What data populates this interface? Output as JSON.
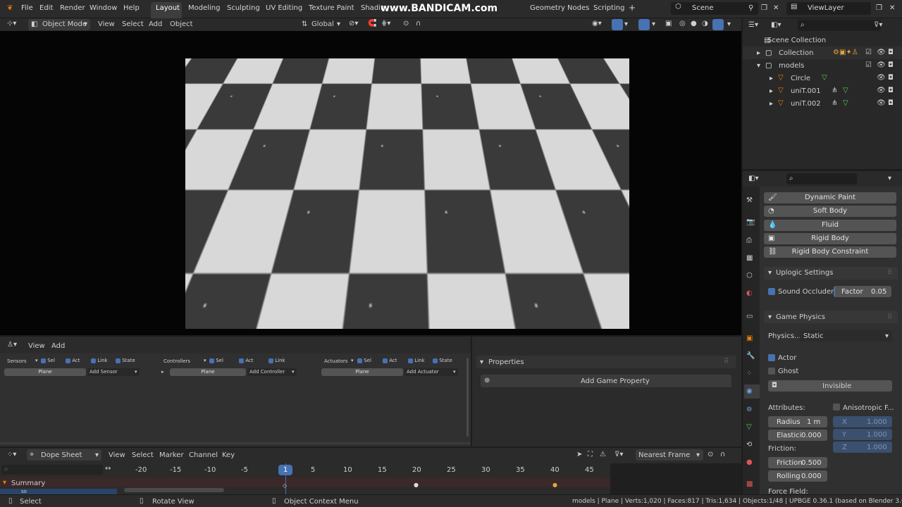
{
  "app": {
    "logo": "blender-logo-icon"
  },
  "menu": [
    "File",
    "Edit",
    "Render",
    "Window",
    "Help"
  ],
  "workspaces": [
    "Layout",
    "Modeling",
    "Sculpting",
    "UV Editing",
    "Texture Paint",
    "Shadin",
    "Geometry Nodes",
    "Scripting"
  ],
  "watermark": "www.BANDICAM.com",
  "scene": {
    "name": "Scene",
    "view_layer": "ViewLayer"
  },
  "viewport_header": {
    "mode": "Object Mode",
    "menus": [
      "View",
      "Select",
      "Add",
      "Object"
    ],
    "orientation": "Global"
  },
  "outliner": {
    "root": "Scene Collection",
    "items": [
      {
        "label": "Collection"
      },
      {
        "label": "models"
      },
      {
        "label": "Circle"
      },
      {
        "label": "uniT.001"
      },
      {
        "label": "uniT.002"
      }
    ]
  },
  "properties": {
    "physics_buttons": [
      "Dynamic Paint",
      "Soft Body",
      "Fluid",
      "Rigid Body",
      "Rigid Body Constraint"
    ],
    "uplogic": {
      "title": "Uplogic Settings",
      "sound_occluder": "Sound Occluder",
      "factor_label": "Factor",
      "factor_value": "0.05"
    },
    "game_physics": {
      "title": "Game Physics",
      "physics_label": "Physics...",
      "physics_type": "Static",
      "actor": "Actor",
      "ghost": "Ghost",
      "invisible": "Invisible",
      "attributes_label": "Attributes:",
      "anisotropic": "Anisotropic F...",
      "radius_label": "Radius",
      "radius_value": "1 m",
      "elastic_label": "Elastici",
      "elastic_value": "0.000",
      "x_label": "X",
      "x_value": "1.000",
      "y_label": "Y",
      "y_value": "1.000",
      "z_label": "Z",
      "z_value": "1.000",
      "friction_label": "Friction:",
      "friction_field_label": "Friction",
      "friction_value": "0.500",
      "rolling_label": "Rolling",
      "rolling_value": "0.000",
      "force_field": "Force Field:"
    }
  },
  "logic_editor": {
    "menus": [
      "View",
      "Add"
    ],
    "sensors": {
      "label": "Sensors",
      "flags": [
        "Sel",
        "Act",
        "Link",
        "State"
      ],
      "object": "Plane",
      "add": "Add Sensor"
    },
    "controllers": {
      "label": "Controllers",
      "flags": [
        "Sel",
        "Act",
        "Link"
      ],
      "object": "Plane",
      "add": "Add Controller"
    },
    "actuators": {
      "label": "Actuators",
      "flags": [
        "Sel",
        "Act",
        "Link",
        "State"
      ],
      "object": "Plane",
      "add": "Add Actuator"
    }
  },
  "game_properties": {
    "title": "Properties",
    "add": "Add Game Property"
  },
  "dopesheet": {
    "mode": "Dope Sheet",
    "menus": [
      "View",
      "Select",
      "Marker",
      "Channel",
      "Key"
    ],
    "snap": "Nearest Frame",
    "frames": [
      "-20",
      "-15",
      "-10",
      "-5",
      "1",
      "5",
      "10",
      "15",
      "20",
      "25",
      "30",
      "35",
      "40",
      "45"
    ],
    "current_frame": "1",
    "summary": "Summary",
    "next_row": "so"
  },
  "statusbar": {
    "left": "Select",
    "middle": "Rotate View",
    "right": "Object Context Menu",
    "info": "models | Plane | Verts:1,020 | Faces:817 | Tris:1,634 | Objects:1/48 | UPBGE 0.36.1 (based on Blender 3.6.2)"
  },
  "colors": {
    "accent": "#4772b3",
    "header": "#2b2b2b",
    "panel": "#303030"
  }
}
